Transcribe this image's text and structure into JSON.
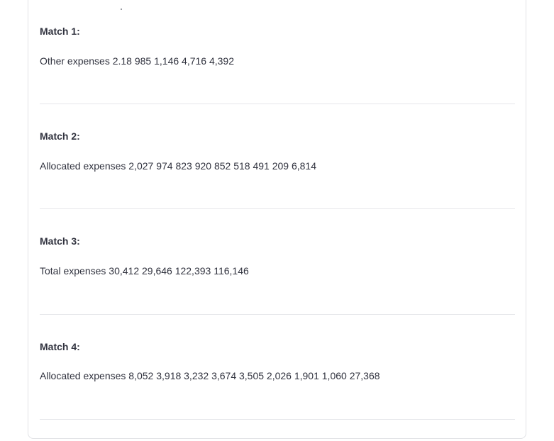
{
  "matches": [
    {
      "title": "Match 1:",
      "text": "Other expenses 2.18 985 1,146 4,716 4,392"
    },
    {
      "title": "Match 2:",
      "text": "Allocated expenses 2,027 974 823 920 852 518 491 209 6,814"
    },
    {
      "title": "Match 3:",
      "text": "Total expenses 30,412 29,646 122,393 116,146"
    },
    {
      "title": "Match 4:",
      "text": "Allocated expenses 8,052 3,918 3,232 3,674 3,505 2,026 1,901 1,060 27,368"
    }
  ]
}
